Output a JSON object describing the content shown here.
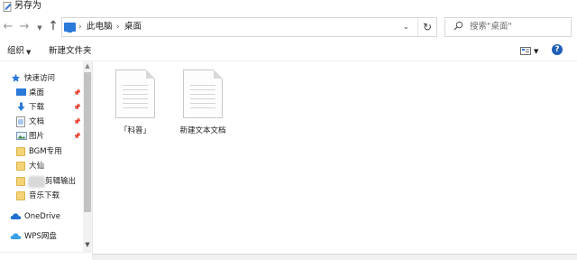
{
  "window": {
    "title": "另存为"
  },
  "address": {
    "crumbs": [
      "此电脑",
      "桌面"
    ],
    "separator": "›"
  },
  "search": {
    "placeholder": "搜索\"桌面\""
  },
  "toolbar": {
    "organize_label": "组织",
    "new_folder_label": "新建文件夹"
  },
  "sidebar": {
    "items": [
      {
        "label": "快速访问",
        "icon": "star-icon"
      },
      {
        "label": "桌面",
        "icon": "desktop-icon",
        "pinned": true
      },
      {
        "label": "下载",
        "icon": "download-icon",
        "pinned": true
      },
      {
        "label": "文档",
        "icon": "document-icon",
        "pinned": true
      },
      {
        "label": "图片",
        "icon": "picture-icon",
        "pinned": true
      },
      {
        "label": "BGM专用",
        "icon": "folder-icon"
      },
      {
        "label": "大仙",
        "icon": "folder-icon"
      },
      {
        "label": "剪辑输出",
        "icon": "folder-icon"
      },
      {
        "label": "音乐下载",
        "icon": "folder-icon"
      },
      {
        "label": "OneDrive",
        "icon": "cloud-icon"
      },
      {
        "label": "WPS网盘",
        "icon": "cloud-icon"
      }
    ]
  },
  "files": [
    {
      "name": "「科普」",
      "icon": "text-file-icon"
    },
    {
      "name": "新建文本文档",
      "icon": "text-file-icon"
    }
  ],
  "colors": {
    "accent": "#2b79d8",
    "folder": "#f5d478",
    "help": "#1f5fb6"
  }
}
